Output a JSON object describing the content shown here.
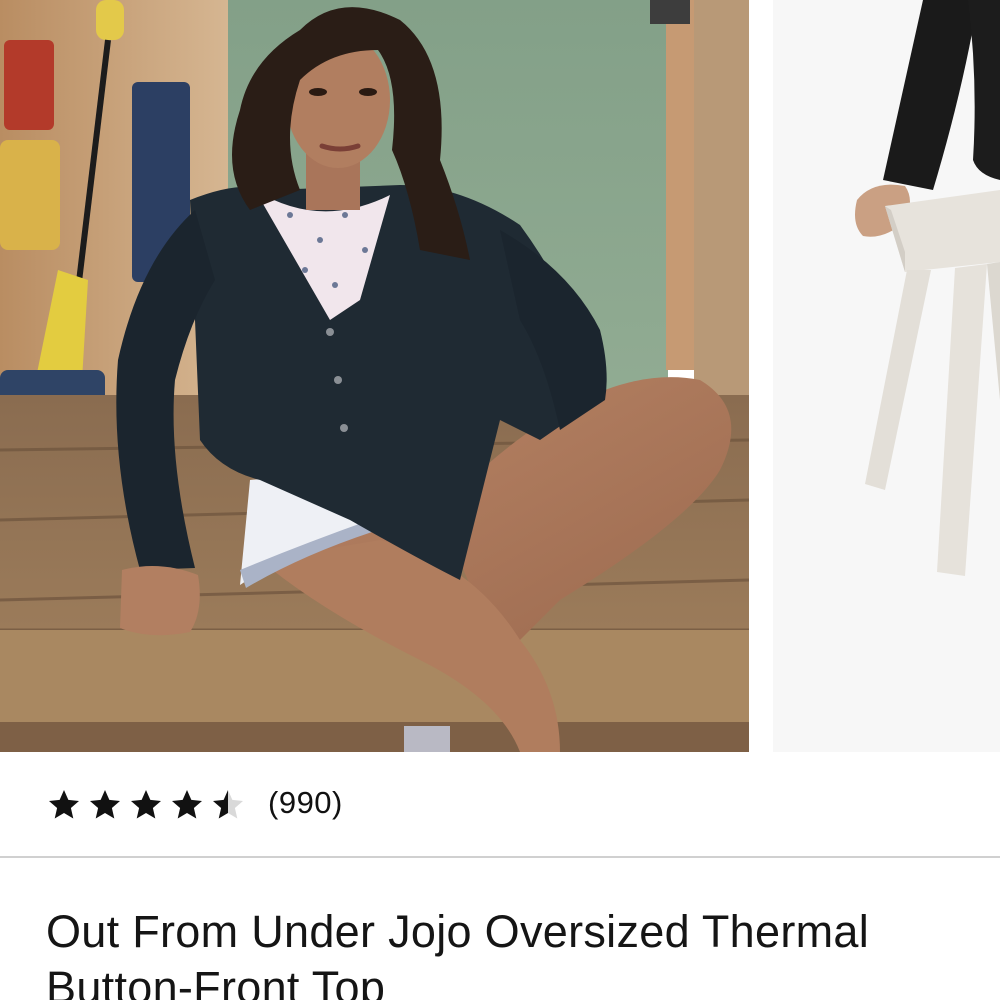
{
  "gallery": {
    "images": [
      {
        "subject": "model in black oversized thermal cardigan sitting on wooden porch",
        "active": true
      },
      {
        "subject": "model in black top leaning on white wooden stool",
        "active": false
      }
    ]
  },
  "rating": {
    "value": 4.5,
    "max": 5,
    "count_label": "(990)",
    "star_color": "#111111",
    "empty_star_color": "#d9d9d9"
  },
  "product": {
    "title": "Out From Under Jojo Oversized Thermal Button-Front Top"
  },
  "colors": {
    "divider": "#d0d0d0",
    "text": "#151515"
  }
}
